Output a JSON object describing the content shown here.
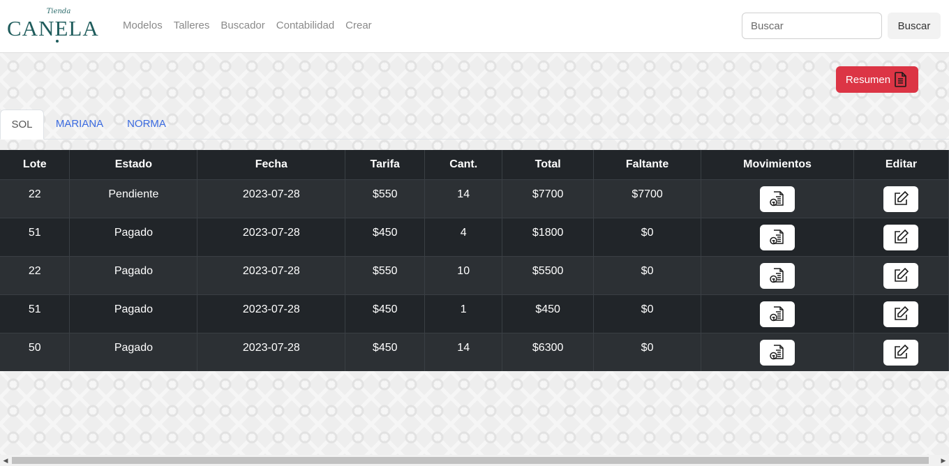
{
  "logo": {
    "small": "Tienda",
    "main": "CANELA"
  },
  "nav": {
    "links": [
      "Modelos",
      "Talleres",
      "Buscador",
      "Contabilidad",
      "Crear"
    ]
  },
  "search": {
    "placeholder": "Buscar",
    "button_label": "Buscar"
  },
  "resumen_label": "Resumen",
  "tabs": [
    {
      "label": "SOL",
      "active": true
    },
    {
      "label": "MARIANA",
      "active": false
    },
    {
      "label": "NORMA",
      "active": false
    }
  ],
  "table": {
    "headers": [
      "Lote",
      "Estado",
      "Fecha",
      "Tarifa",
      "Cant.",
      "Total",
      "Faltante",
      "Movimientos",
      "Editar"
    ],
    "rows": [
      {
        "lote": "22",
        "estado": "Pendiente",
        "fecha": "2023-07-28",
        "tarifa": "$550",
        "cant": "14",
        "total": "$7700",
        "faltante": "$7700"
      },
      {
        "lote": "51",
        "estado": "Pagado",
        "fecha": "2023-07-28",
        "tarifa": "$450",
        "cant": "4",
        "total": "$1800",
        "faltante": "$0"
      },
      {
        "lote": "22",
        "estado": "Pagado",
        "fecha": "2023-07-28",
        "tarifa": "$550",
        "cant": "10",
        "total": "$5500",
        "faltante": "$0"
      },
      {
        "lote": "51",
        "estado": "Pagado",
        "fecha": "2023-07-28",
        "tarifa": "$450",
        "cant": "1",
        "total": "$450",
        "faltante": "$0"
      },
      {
        "lote": "50",
        "estado": "Pagado",
        "fecha": "2023-07-28",
        "tarifa": "$450",
        "cant": "14",
        "total": "$6300",
        "faltante": "$0"
      }
    ]
  },
  "colors": {
    "brand": "#1f5c5c",
    "danger": "#dc3545",
    "link": "#3b6be0",
    "table_dark": "#212529",
    "table_striped": "#2c3034"
  },
  "icons": {
    "resumen": "document-text-icon",
    "movimientos": "document-payment-icon",
    "editar": "edit-pencil-icon"
  }
}
